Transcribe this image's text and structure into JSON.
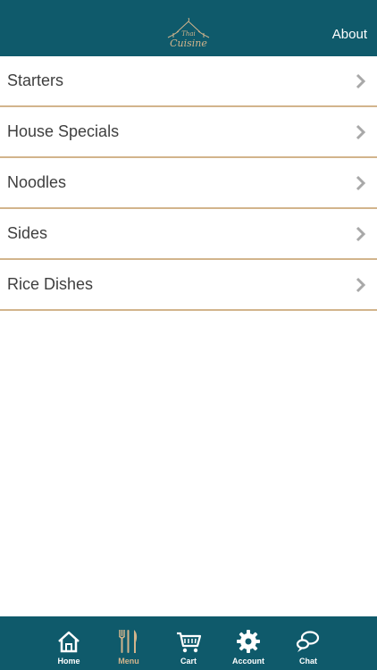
{
  "header": {
    "logo_icon": "thai-cuisine-logo-icon",
    "logo_text_top": "Thai",
    "logo_text_bottom": "Cuisine",
    "about_label": "About"
  },
  "menu": {
    "items": [
      {
        "label": "Starters",
        "icon": "chevron-right-icon"
      },
      {
        "label": "House Specials",
        "icon": "chevron-right-icon"
      },
      {
        "label": "Noodles",
        "icon": "chevron-right-icon"
      },
      {
        "label": "Sides",
        "icon": "chevron-right-icon"
      },
      {
        "label": "Rice Dishes",
        "icon": "chevron-right-icon"
      }
    ]
  },
  "tabbar": {
    "active_tab": "Menu",
    "tabs": [
      {
        "label": "Home",
        "icon": "home-icon"
      },
      {
        "label": "Menu",
        "icon": "fork-knife-icon"
      },
      {
        "label": "Cart",
        "icon": "cart-icon"
      },
      {
        "label": "Account",
        "icon": "gear-icon"
      },
      {
        "label": "Chat",
        "icon": "chat-bubbles-icon"
      }
    ]
  },
  "colors": {
    "primary": "#0f5a6b",
    "accent": "#d2b48c",
    "text": "#3f3f3f",
    "chevron": "#a8a8a8",
    "background": "#ffffff"
  }
}
